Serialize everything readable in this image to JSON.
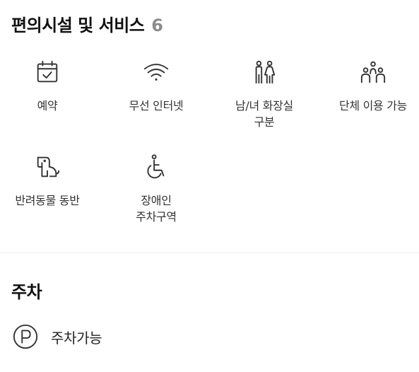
{
  "amenities_section": {
    "title": "편의시설 및 서비스",
    "count": "6",
    "items": [
      {
        "icon": "calendar-check-icon",
        "label_line1": "예약",
        "label_line2": ""
      },
      {
        "icon": "wifi-icon",
        "label_line1": "무선 인터넷",
        "label_line2": ""
      },
      {
        "icon": "gender-restroom-icon",
        "label_line1": "남/녀 화장실",
        "label_line2": "구분"
      },
      {
        "icon": "group-people-icon",
        "label_line1": "단체 이용 가능",
        "label_line2": ""
      },
      {
        "icon": "dog-icon",
        "label_line1": "반려동물 동반",
        "label_line2": ""
      },
      {
        "icon": "wheelchair-icon",
        "label_line1": "장애인",
        "label_line2": "주차구역"
      }
    ]
  },
  "parking_section": {
    "title": "주차",
    "icon": "parking-icon",
    "label": "주차가능"
  }
}
